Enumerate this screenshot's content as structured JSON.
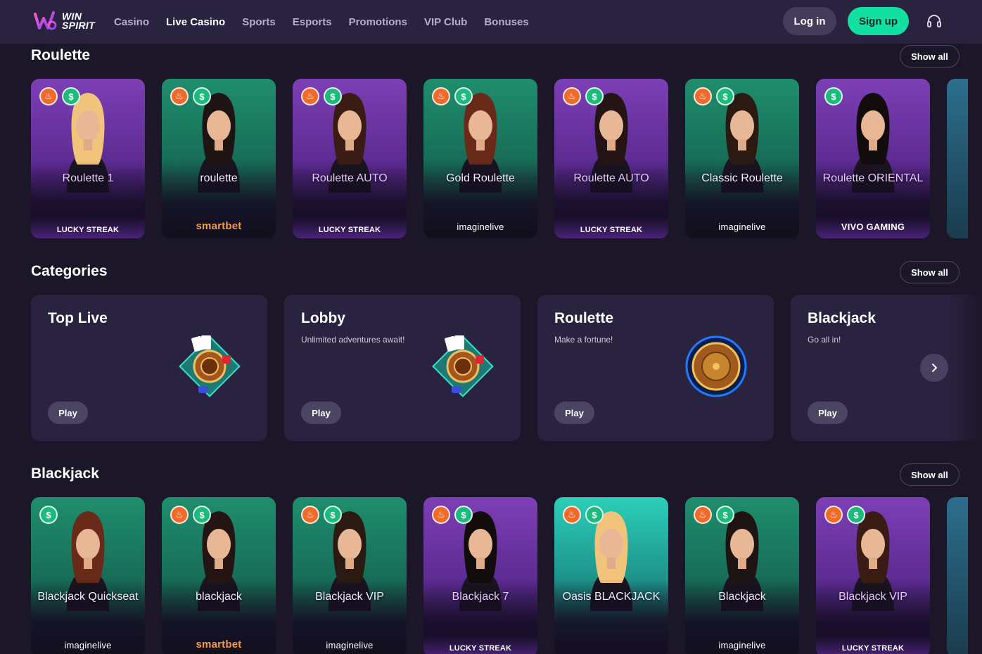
{
  "header": {
    "logo_line1": "WIN",
    "logo_line2": "SPIRIT",
    "nav": [
      "Casino",
      "Live Casino",
      "Sports",
      "Esports",
      "Promotions",
      "VIP Club",
      "Bonuses"
    ],
    "active_nav": "Live Casino",
    "login_label": "Log in",
    "signup_label": "Sign up",
    "accent": "#11e0a0"
  },
  "roulette": {
    "title": "Roulette",
    "show_all": "Show all",
    "games": [
      {
        "name": "Roulette 1",
        "provider": "LUCKY STREAK",
        "bg": "purple",
        "badges": [
          "fire",
          "dollar"
        ]
      },
      {
        "name": "roulette",
        "provider": "smartbet",
        "bg": "green",
        "badges": [
          "fire",
          "dollar"
        ]
      },
      {
        "name": "Roulette AUTO",
        "provider": "LUCKY STREAK",
        "bg": "purple",
        "badges": [
          "fire",
          "dollar"
        ]
      },
      {
        "name": "Gold Roulette",
        "provider": "imaginelive",
        "bg": "green",
        "badges": [
          "fire",
          "dollar"
        ]
      },
      {
        "name": "Roulette AUTO",
        "provider": "LUCKY STREAK",
        "bg": "purple",
        "badges": [
          "fire",
          "dollar"
        ]
      },
      {
        "name": "Classic Roulette",
        "provider": "imaginelive",
        "bg": "green",
        "badges": [
          "fire",
          "dollar"
        ]
      },
      {
        "name": "Roulette ORIENTAL",
        "provider": "VIVO GAMING",
        "bg": "purple",
        "badges": [
          "dollar"
        ]
      }
    ]
  },
  "categories": {
    "title": "Categories",
    "show_all": "Show all",
    "items": [
      {
        "title": "Top Live",
        "subtitle": "",
        "play": "Play"
      },
      {
        "title": "Lobby",
        "subtitle": "Unlimited adventures await!",
        "play": "Play"
      },
      {
        "title": "Roulette",
        "subtitle": "Make a fortune!",
        "play": "Play"
      },
      {
        "title": "Blackjack",
        "subtitle": "Go all in!",
        "play": "Play"
      }
    ]
  },
  "blackjack": {
    "title": "Blackjack",
    "show_all": "Show all",
    "games": [
      {
        "name": "Blackjack Quickseat",
        "provider": "imaginelive",
        "bg": "green",
        "badges": [
          "dollar"
        ]
      },
      {
        "name": "blackjack",
        "provider": "smartbet",
        "bg": "green",
        "badges": [
          "fire",
          "dollar"
        ]
      },
      {
        "name": "Blackjack VIP",
        "provider": "imaginelive",
        "bg": "green",
        "badges": [
          "fire",
          "dollar"
        ]
      },
      {
        "name": "Blackjack 7",
        "provider": "LUCKY STREAK",
        "bg": "purple",
        "badges": [
          "fire",
          "dollar"
        ]
      },
      {
        "name": "Oasis BLACKJACK",
        "provider": "",
        "bg": "teal",
        "badges": [
          "fire",
          "dollar"
        ]
      },
      {
        "name": "Blackjack",
        "provider": "imaginelive",
        "bg": "green",
        "badges": [
          "fire",
          "dollar"
        ]
      },
      {
        "name": "Blackjack VIP",
        "provider": "LUCKY STREAK",
        "bg": "purple",
        "badges": [
          "fire",
          "dollar"
        ]
      }
    ]
  }
}
